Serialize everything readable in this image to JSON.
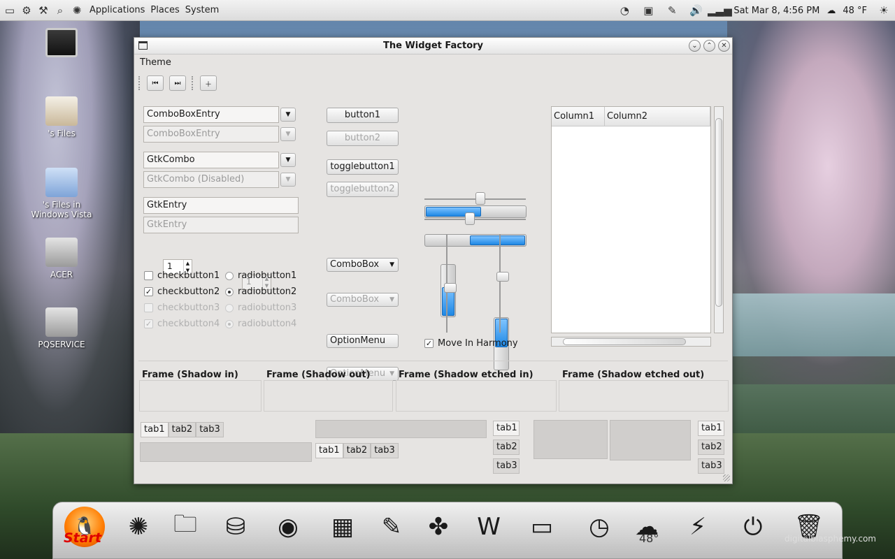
{
  "panel": {
    "menus": [
      "Applications",
      "Places",
      "System"
    ],
    "clock": "Sat Mar  8,  4:56 PM",
    "weather": "48 °F"
  },
  "desktop": {
    "icons": [
      {
        "label": ""
      },
      {
        "label": "'s Files"
      },
      {
        "label": "'s Files in Windows Vista"
      },
      {
        "label": "ACER"
      },
      {
        "label": "PQSERVICE"
      }
    ]
  },
  "window": {
    "title": "The Widget Factory",
    "menu": "Theme",
    "col1": {
      "combo_entry_1": "ComboBoxEntry",
      "combo_entry_2": "ComboBoxEntry",
      "gtk_combo_1": "GtkCombo",
      "gtk_combo_2": "GtkCombo (Disabled)",
      "entry_1": "GtkEntry",
      "entry_2": "GtkEntry",
      "spin_1": "1",
      "spin_2": "1",
      "check": [
        "checkbutton1",
        "checkbutton2",
        "checkbutton3",
        "checkbutton4"
      ],
      "radio": [
        "radiobutton1",
        "radiobutton2",
        "radiobutton3",
        "radiobutton4"
      ]
    },
    "col2": {
      "button1": "button1",
      "button2": "button2",
      "toggle1": "togglebutton1",
      "toggle2": "togglebutton2",
      "combobox1": "ComboBox",
      "combobox2": "ComboBox",
      "option1": "OptionMenu",
      "option2": "OptionMenu"
    },
    "col3": {
      "progress_h1": 0.55,
      "progress_h2": 0.55,
      "progress_v1": 0.55,
      "progress_v2": 0.55,
      "harmony": "Move In Harmony"
    },
    "tree": {
      "columns": [
        "Column1",
        "Column2"
      ]
    },
    "frames": [
      "Frame (Shadow in)",
      "Frame (Shadow out)",
      "Frame (Shadow etched in)",
      "Frame (Shadow etched out)"
    ],
    "tabs": [
      "tab1",
      "tab2",
      "tab3"
    ]
  },
  "dock": {
    "start": "Start",
    "temp": "48°",
    "watermark": "digitalblasphemy.com"
  }
}
